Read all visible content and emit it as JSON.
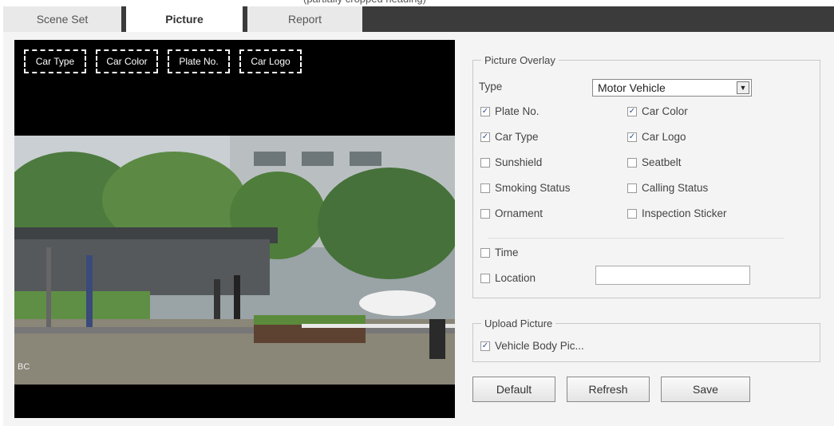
{
  "tabs": [
    {
      "label": "Scene Set",
      "active": false
    },
    {
      "label": "Picture",
      "active": true
    },
    {
      "label": "Report",
      "active": false
    }
  ],
  "video": {
    "overlay_boxes": [
      "Car Type",
      "Car Color",
      "Plate No.",
      "Car Logo"
    ],
    "camera_label": "BC"
  },
  "picture_overlay": {
    "legend": "Picture Overlay",
    "type_label": "Type",
    "type_value": "Motor Vehicle",
    "options": [
      {
        "label": "Plate No.",
        "checked": true
      },
      {
        "label": "Car Color",
        "checked": true
      },
      {
        "label": "Car Type",
        "checked": true
      },
      {
        "label": "Car Logo",
        "checked": true
      },
      {
        "label": "Sunshield",
        "checked": false
      },
      {
        "label": "Seatbelt",
        "checked": false
      },
      {
        "label": "Smoking Status",
        "checked": false
      },
      {
        "label": "Calling Status",
        "checked": false
      },
      {
        "label": "Ornament",
        "checked": false
      },
      {
        "label": "Inspection Sticker",
        "checked": false
      }
    ],
    "time": {
      "label": "Time",
      "checked": false
    },
    "location": {
      "label": "Location",
      "checked": false,
      "value": ""
    }
  },
  "upload_picture": {
    "legend": "Upload Picture",
    "vehicle_body": {
      "label": "Vehicle Body Pic...",
      "checked": true
    }
  },
  "buttons": {
    "default": "Default",
    "refresh": "Refresh",
    "save": "Save"
  },
  "colors": {
    "tab_bar": "#3b3b3b",
    "panel_bg": "#f4f4f4",
    "check_mark": "#2a4f8f"
  },
  "icons": {
    "dropdown": "chevron-down-icon",
    "checkbox": "checkmark-icon"
  }
}
